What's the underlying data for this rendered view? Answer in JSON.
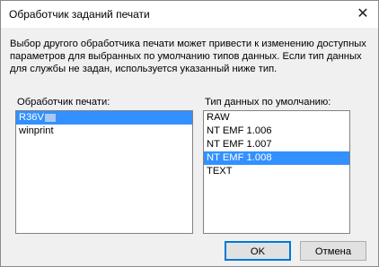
{
  "dialog": {
    "title": "Обработчик заданий печати",
    "close_glyph": "✕",
    "description": "Выбор другого обработчика печати может привести к изменению доступных параметров для выбранных по умолчанию типов данных. Если тип данных для службы не задан, используется указанный ниже тип."
  },
  "processor_list": {
    "label": "Обработчик печати:",
    "items": [
      "R36V",
      "winprint"
    ],
    "selected": "R36V"
  },
  "datatype_list": {
    "label": "Тип данных по умолчанию:",
    "items": [
      "RAW",
      "NT EMF 1.006",
      "NT EMF 1.007",
      "NT EMF 1.008",
      "TEXT"
    ],
    "selected": "NT EMF 1.008"
  },
  "buttons": {
    "ok": "OK",
    "cancel": "Отмена"
  },
  "colors": {
    "selection": "#3390ff",
    "default_button_border": "#0078d7"
  }
}
